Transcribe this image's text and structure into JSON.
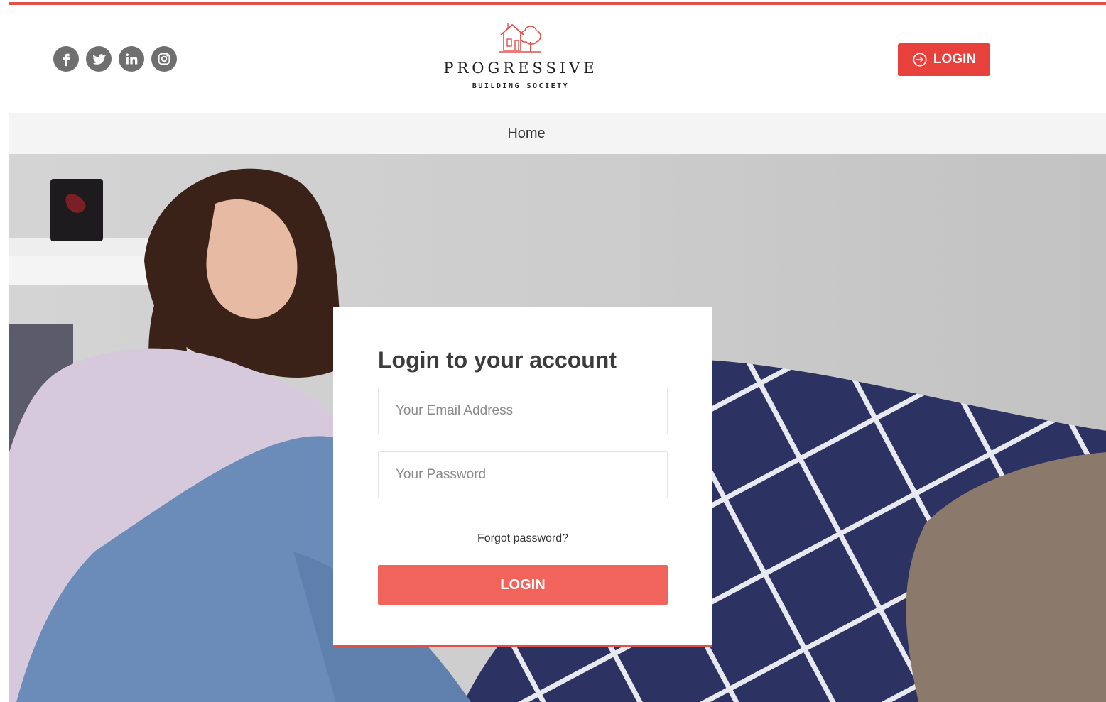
{
  "header": {
    "social": [
      {
        "name": "facebook-icon"
      },
      {
        "name": "twitter-icon"
      },
      {
        "name": "linkedin-icon"
      },
      {
        "name": "instagram-icon"
      }
    ],
    "logo": {
      "name": "PROGRESSIVE",
      "subtitle": "BUILDING SOCIETY"
    },
    "login_label": "LOGIN"
  },
  "nav": {
    "home": "Home"
  },
  "login_form": {
    "title": "Login to your account",
    "email_placeholder": "Your Email Address",
    "password_placeholder": "Your Password",
    "forgot_label": "Forgot password?",
    "submit_label": "LOGIN"
  },
  "colors": {
    "accent": "#e8403a",
    "button": "#f0645c",
    "social_icon": "#6f6f6f"
  }
}
